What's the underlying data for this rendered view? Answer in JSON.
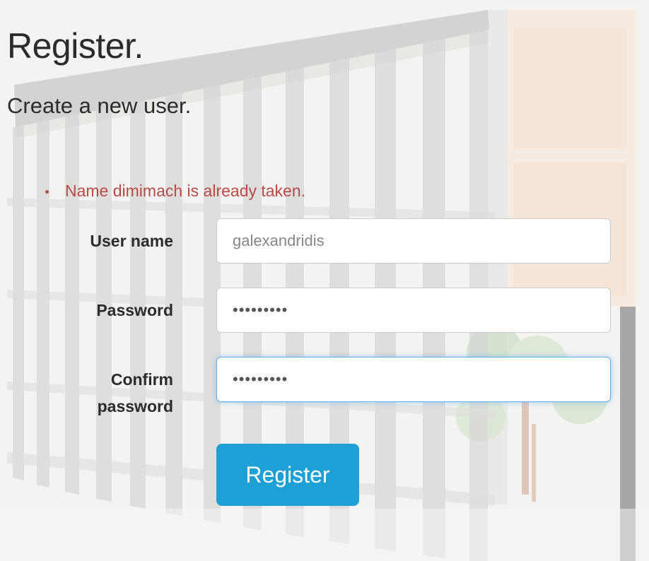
{
  "page": {
    "title": "Register.",
    "subtitle": "Create a new user."
  },
  "validation": {
    "errors": [
      "Name dimimach is already taken."
    ],
    "error_color": "#b94a48"
  },
  "form": {
    "username": {
      "label": "User name",
      "value": "galexandridis"
    },
    "password": {
      "label": "Password",
      "value": "•••••••••"
    },
    "confirm_password": {
      "label_line1": "Confirm",
      "label_line2": "password",
      "value": "•••••••••"
    },
    "submit_label": "Register"
  },
  "colors": {
    "accent": "#1e9fd6",
    "focus_border": "#66afe9",
    "text": "#2b2b2b"
  }
}
